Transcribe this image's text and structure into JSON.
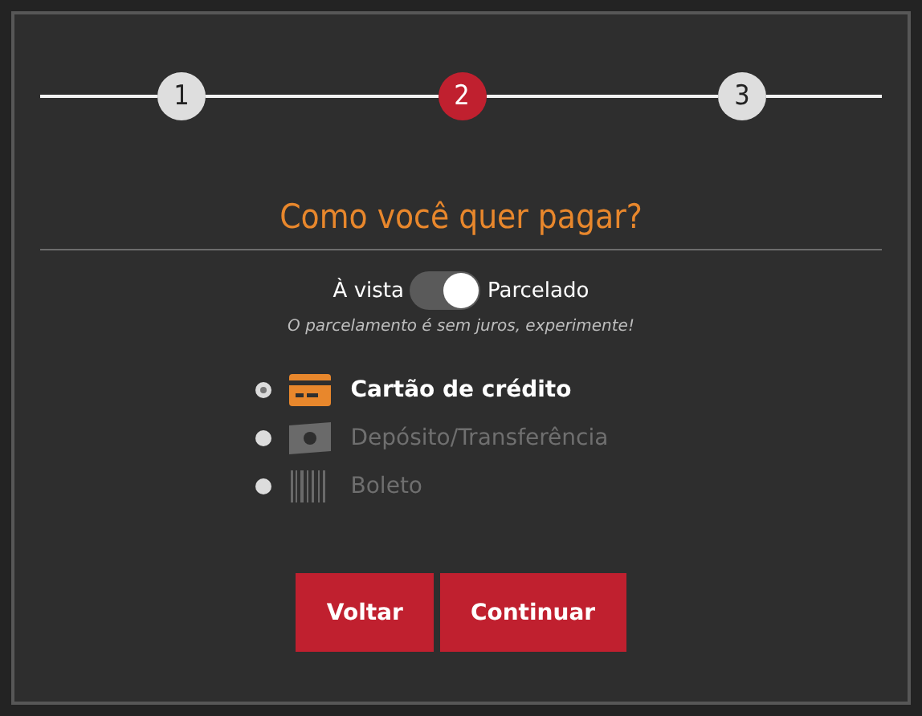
{
  "steps": [
    {
      "label": "1",
      "selected": false
    },
    {
      "label": "2",
      "selected": true
    },
    {
      "label": "3",
      "selected": false
    }
  ],
  "title": "Como você quer pagar?",
  "installments": {
    "left_label": "À vista",
    "on": true,
    "right_label": "Parcelado",
    "note": "O parcelamento é sem juros, experimente!"
  },
  "payment_methods": [
    {
      "kind": "card",
      "label": "Cartão de crédito",
      "selected": true
    },
    {
      "kind": "cash",
      "label": "Depósito/Transferência",
      "selected": false
    },
    {
      "kind": "barcode",
      "label": "Boleto",
      "selected": false
    }
  ],
  "buttons": [
    "Voltar",
    "Continuar"
  ]
}
